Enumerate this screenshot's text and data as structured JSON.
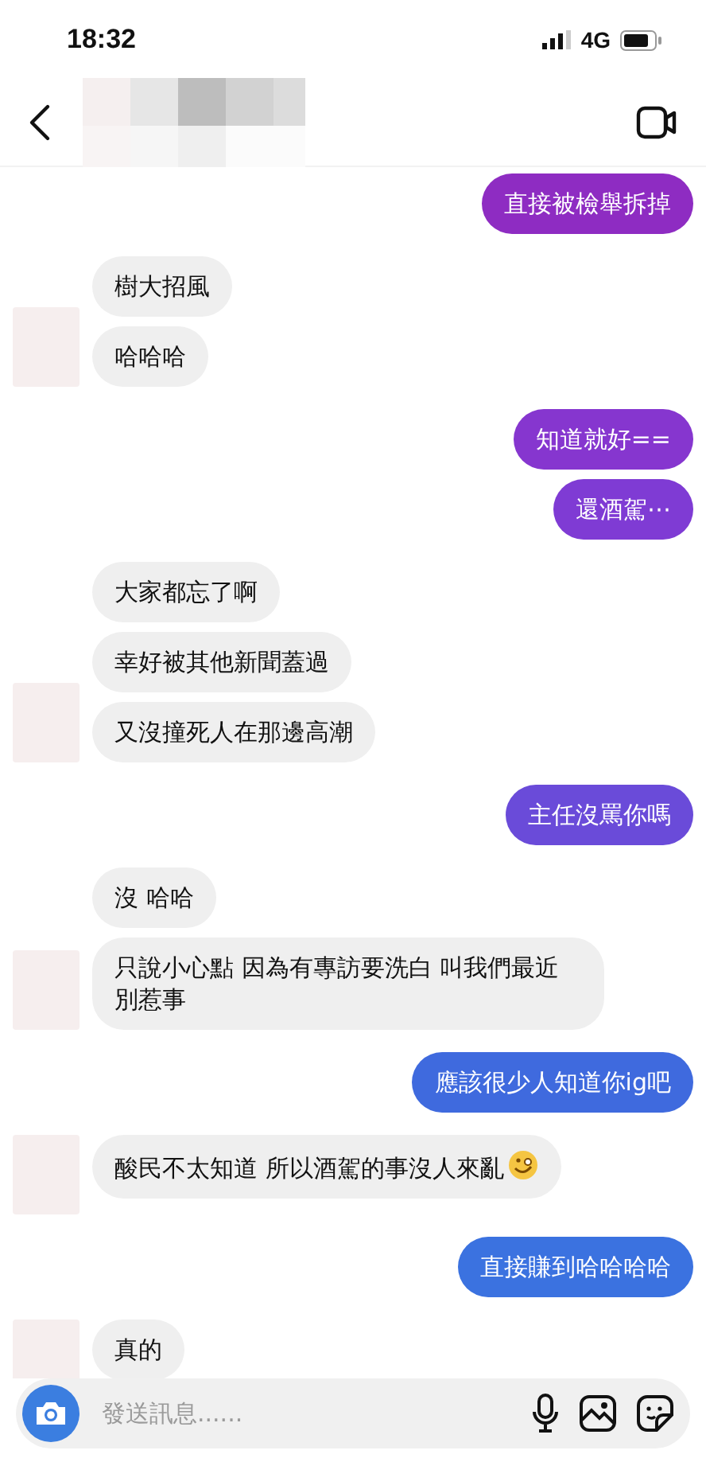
{
  "status_bar": {
    "time": "18:32",
    "network": "4G"
  },
  "groups": [
    {
      "kind": "sent",
      "messages": [
        {
          "text": "直接被檢舉拆掉",
          "color": "#8e2cc2"
        }
      ]
    },
    {
      "kind": "received",
      "messages": [
        {
          "text": "樹大招風"
        },
        {
          "text": "哈哈哈"
        }
      ]
    },
    {
      "kind": "sent",
      "messages": [
        {
          "text": "知道就好==",
          "color": "#8636cf"
        },
        {
          "text": "還酒駕⋯",
          "color": "#7f3bd4"
        }
      ]
    },
    {
      "kind": "received",
      "messages": [
        {
          "text": "大家都忘了啊"
        },
        {
          "text": "幸好被其他新聞蓋過"
        },
        {
          "text": "又沒撞死人在那邊高潮"
        }
      ]
    },
    {
      "kind": "sent",
      "messages": [
        {
          "text": "主任沒罵你嗎",
          "color": "#6a4bd9"
        }
      ]
    },
    {
      "kind": "received",
      "messages": [
        {
          "text": "沒 哈哈"
        },
        {
          "text": "只說小心點 因為有專訪要洗白 叫我們最近別惹事"
        }
      ]
    },
    {
      "kind": "sent",
      "messages": [
        {
          "text": "應該很少人知道你ig吧",
          "color": "#3f6ade"
        }
      ]
    },
    {
      "kind": "received",
      "messages": [
        {
          "text": "酸民不太知道 所以酒駕的事沒人來亂",
          "emoji": true
        }
      ]
    },
    {
      "kind": "sent",
      "messages": [
        {
          "text": "直接賺到哈哈哈哈",
          "color": "#3b72e0"
        }
      ]
    },
    {
      "kind": "received",
      "messages": [
        {
          "text": "真的"
        }
      ]
    }
  ],
  "composer": {
    "placeholder": "發送訊息......"
  }
}
